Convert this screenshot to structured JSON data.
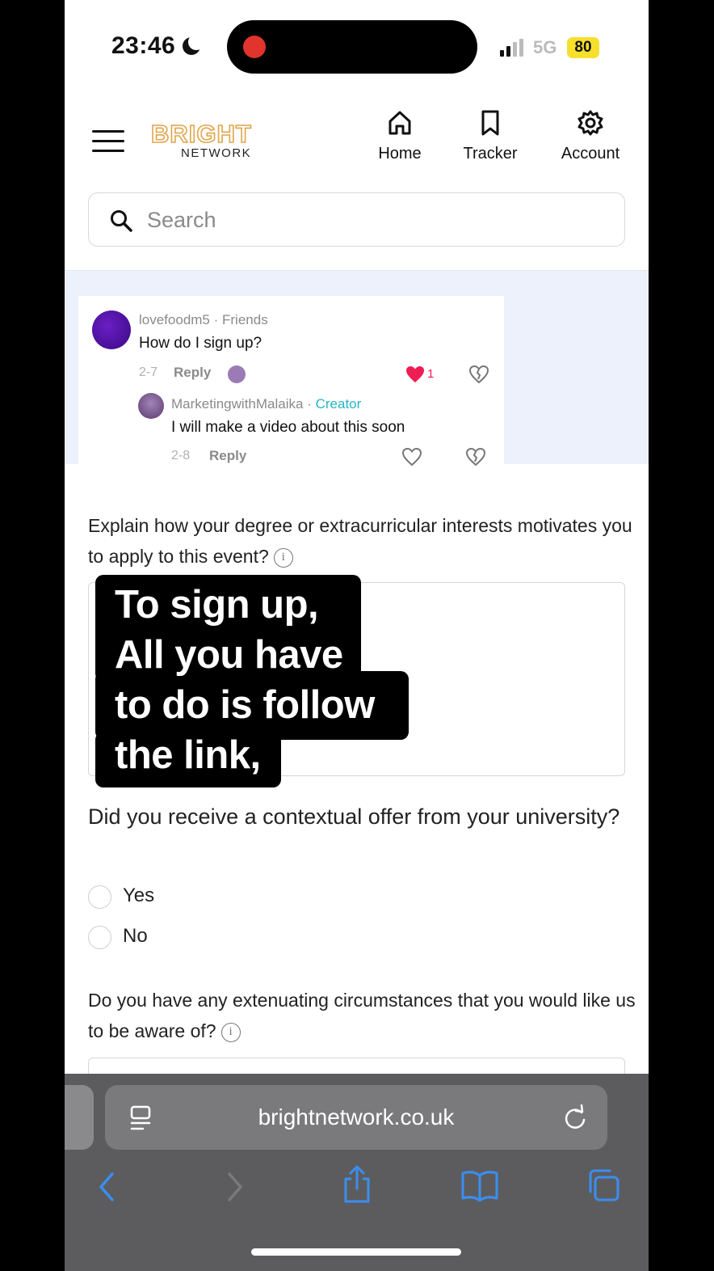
{
  "status_bar": {
    "time": "23:46",
    "network": "5G",
    "battery": "80"
  },
  "header": {
    "logo_top": "BRIGHT",
    "logo_bottom": "NETWORK",
    "nav": [
      {
        "label": "Home",
        "icon": "home-icon"
      },
      {
        "label": "Tracker",
        "icon": "bookmark-icon"
      },
      {
        "label": "Account",
        "icon": "gear-icon"
      }
    ]
  },
  "search": {
    "placeholder": "Search"
  },
  "comments": {
    "first": {
      "user": "lovefoodm5",
      "relation": "· Friends",
      "text": "How do I sign up?",
      "date": "2-7",
      "reply": "Reply",
      "likes": "1"
    },
    "second": {
      "user": "MarketingwithMalaika",
      "separator": "·",
      "badge": "Creator",
      "text": "I will make a video about this soon",
      "date": "2-8",
      "reply": "Reply"
    }
  },
  "form": {
    "q1": "Explain how your degree or extracurricular interests motivates you to apply to this event?",
    "q2": "Did you receive a contextual offer from your university?",
    "options": [
      "Yes",
      "No"
    ],
    "q3": "Do you have any extenuating circumstances that you would like us to be aware of?",
    "info": "i"
  },
  "caption": {
    "lines": [
      "To sign up,",
      "All you have",
      "to do is follow",
      "the link,"
    ]
  },
  "browser": {
    "url": "brightnetwork.co.uk"
  },
  "colors": {
    "logo_accent": "#e0a54a",
    "creator": "#25b5c6",
    "heart": "#ee1d52",
    "safari_blue": "#3a8ef0",
    "comment_bg": "#edf1fc"
  }
}
